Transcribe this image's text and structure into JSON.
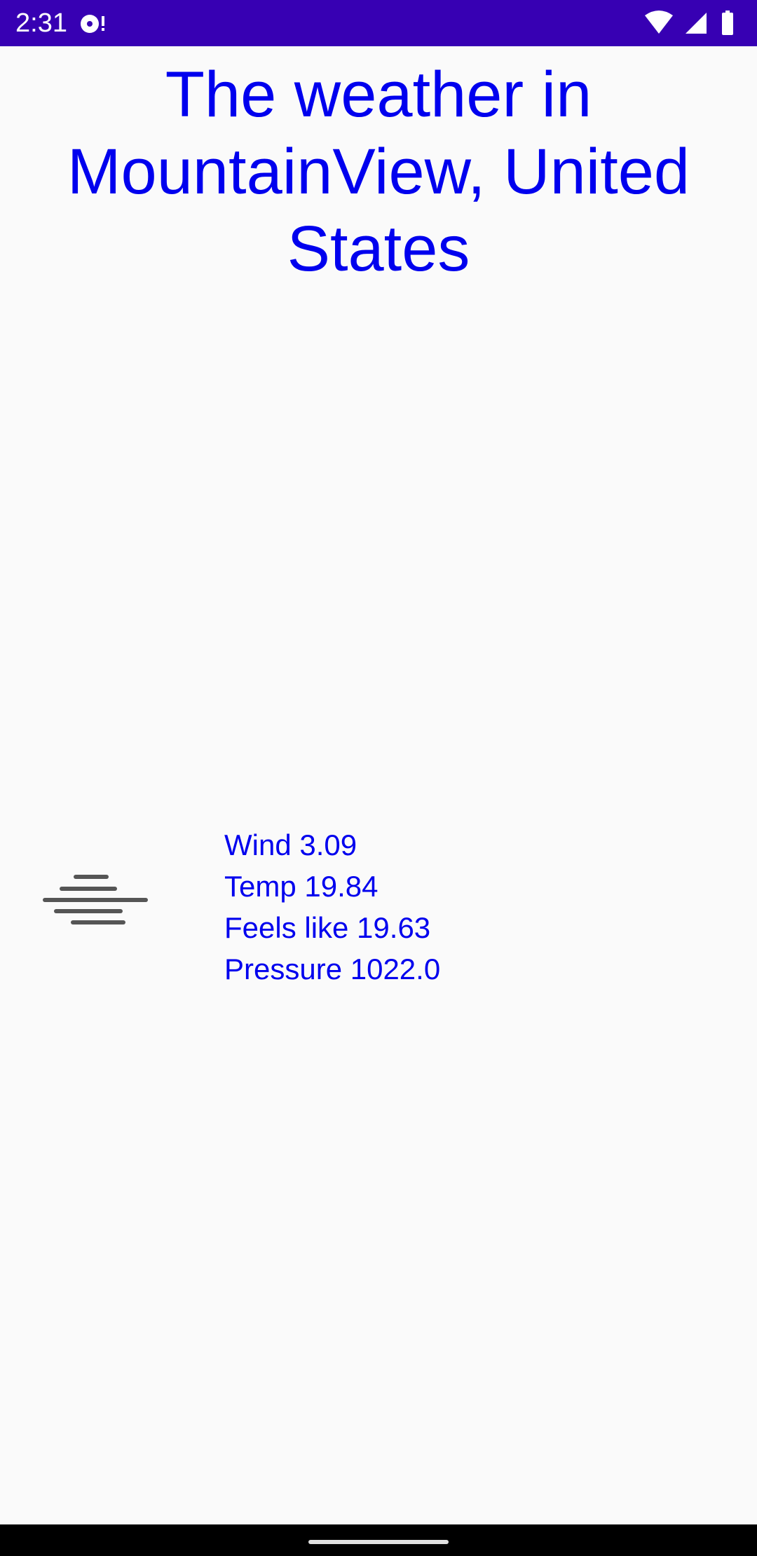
{
  "status_bar": {
    "time": "2:31",
    "notification_icon": "media-notification-icon",
    "wifi_icon": "wifi-icon",
    "signal_icon": "cell-signal-icon",
    "battery_icon": "battery-icon",
    "background_color": "#3700b3"
  },
  "main": {
    "title": "The weather in MountainView, United States",
    "condition_icon": "fog-mist-icon",
    "details": {
      "wind": "Wind 3.09",
      "temp": "Temp 19.84",
      "feels_like": "Feels like 19.63",
      "pressure": "Pressure 1022.0"
    },
    "text_color": "#0000ee"
  },
  "nav_bar": {
    "home_indicator": "home-gesture-pill"
  }
}
